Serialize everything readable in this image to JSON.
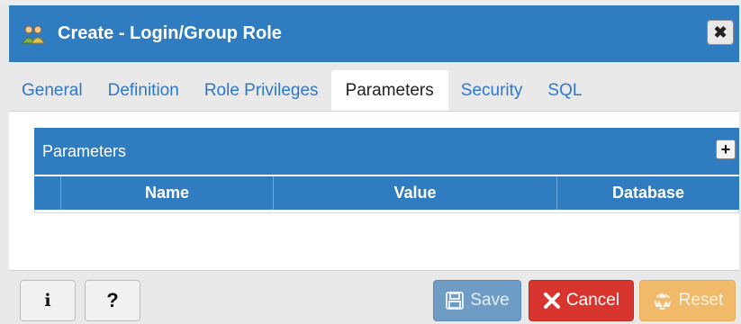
{
  "dialog": {
    "title": "Create - Login/Group Role",
    "title_icon": "role-group-icon",
    "close_icon": "close-icon",
    "close_label": "✖"
  },
  "tabs": [
    {
      "label": "General",
      "active": false
    },
    {
      "label": "Definition",
      "active": false
    },
    {
      "label": "Role Privileges",
      "active": false
    },
    {
      "label": "Parameters",
      "active": true
    },
    {
      "label": "Security",
      "active": false
    },
    {
      "label": "SQL",
      "active": false
    }
  ],
  "parameters_panel": {
    "title": "Parameters",
    "add_label": "+",
    "columns": [
      "Name",
      "Value",
      "Database"
    ],
    "rows": []
  },
  "footer": {
    "info_label": "i",
    "help_label": "?",
    "save_label": "Save",
    "cancel_label": "Cancel",
    "reset_label": "Reset"
  },
  "colors": {
    "header_blue": "#2f7cc0",
    "tab_link": "#2f77c7",
    "save": "#6f9cc4",
    "cancel": "#d9352f",
    "reset": "#f1b96a"
  }
}
